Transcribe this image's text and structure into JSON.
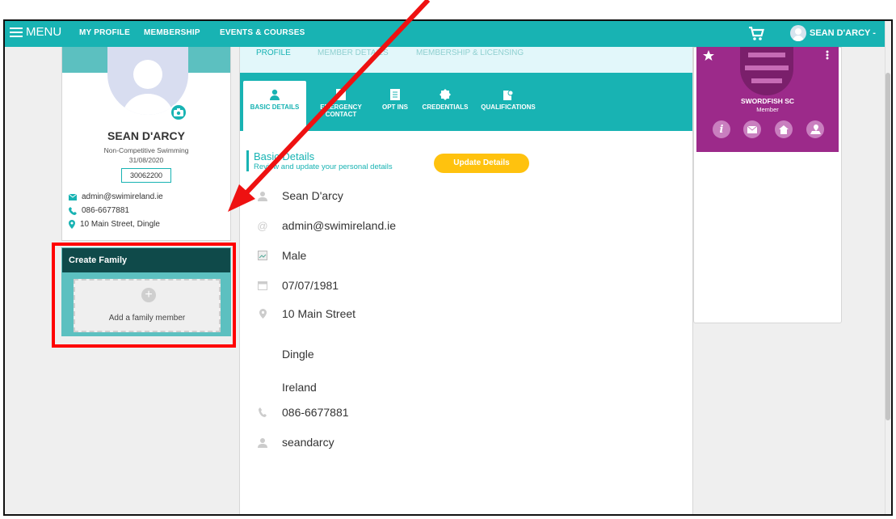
{
  "nav": {
    "menu_label": "MENU",
    "links": [
      "MY PROFILE",
      "MEMBERSHIP",
      "EVENTS & COURSES"
    ],
    "user_name": "SEAN D'ARCY -"
  },
  "profile": {
    "name": "SEAN D'ARCY",
    "membership_type": "Non-Competitive Swimming",
    "date": "31/08/2020",
    "member_id": "30062200",
    "email": "admin@swimireland.ie",
    "phone": "086-6677881",
    "address": "10 Main Street, Dingle"
  },
  "family": {
    "title": "Create Family",
    "add_label": "Add a family member"
  },
  "tabs": {
    "primary": [
      "PROFILE",
      "MEMBER DETAILS",
      "MEMBERSHIP & LICENSING"
    ],
    "secondary": [
      "BASIC DETAILS",
      "EMERGENCY CONTACT",
      "OPT INS",
      "CREDENTIALS",
      "QUALIFICATIONS"
    ]
  },
  "basic": {
    "title": "Basic Details",
    "subtitle": "Review and update your personal details",
    "update_button": "Update Details",
    "name": "Sean D'arcy",
    "email": "admin@swimireland.ie",
    "gender": "Male",
    "dob": "07/07/1981",
    "address1": "10 Main Street",
    "address2": "Dingle",
    "country": "Ireland",
    "phone": "086-6677881",
    "username": "seandarcy"
  },
  "club": {
    "name": "SWORDFISH SC",
    "role": "Member"
  },
  "colors": {
    "teal": "#18b3b3",
    "dark_teal": "#0f4a4a",
    "yellow": "#ffc20e",
    "club_purple": "#9c2a8a",
    "highlight_red": "#ff0000"
  }
}
